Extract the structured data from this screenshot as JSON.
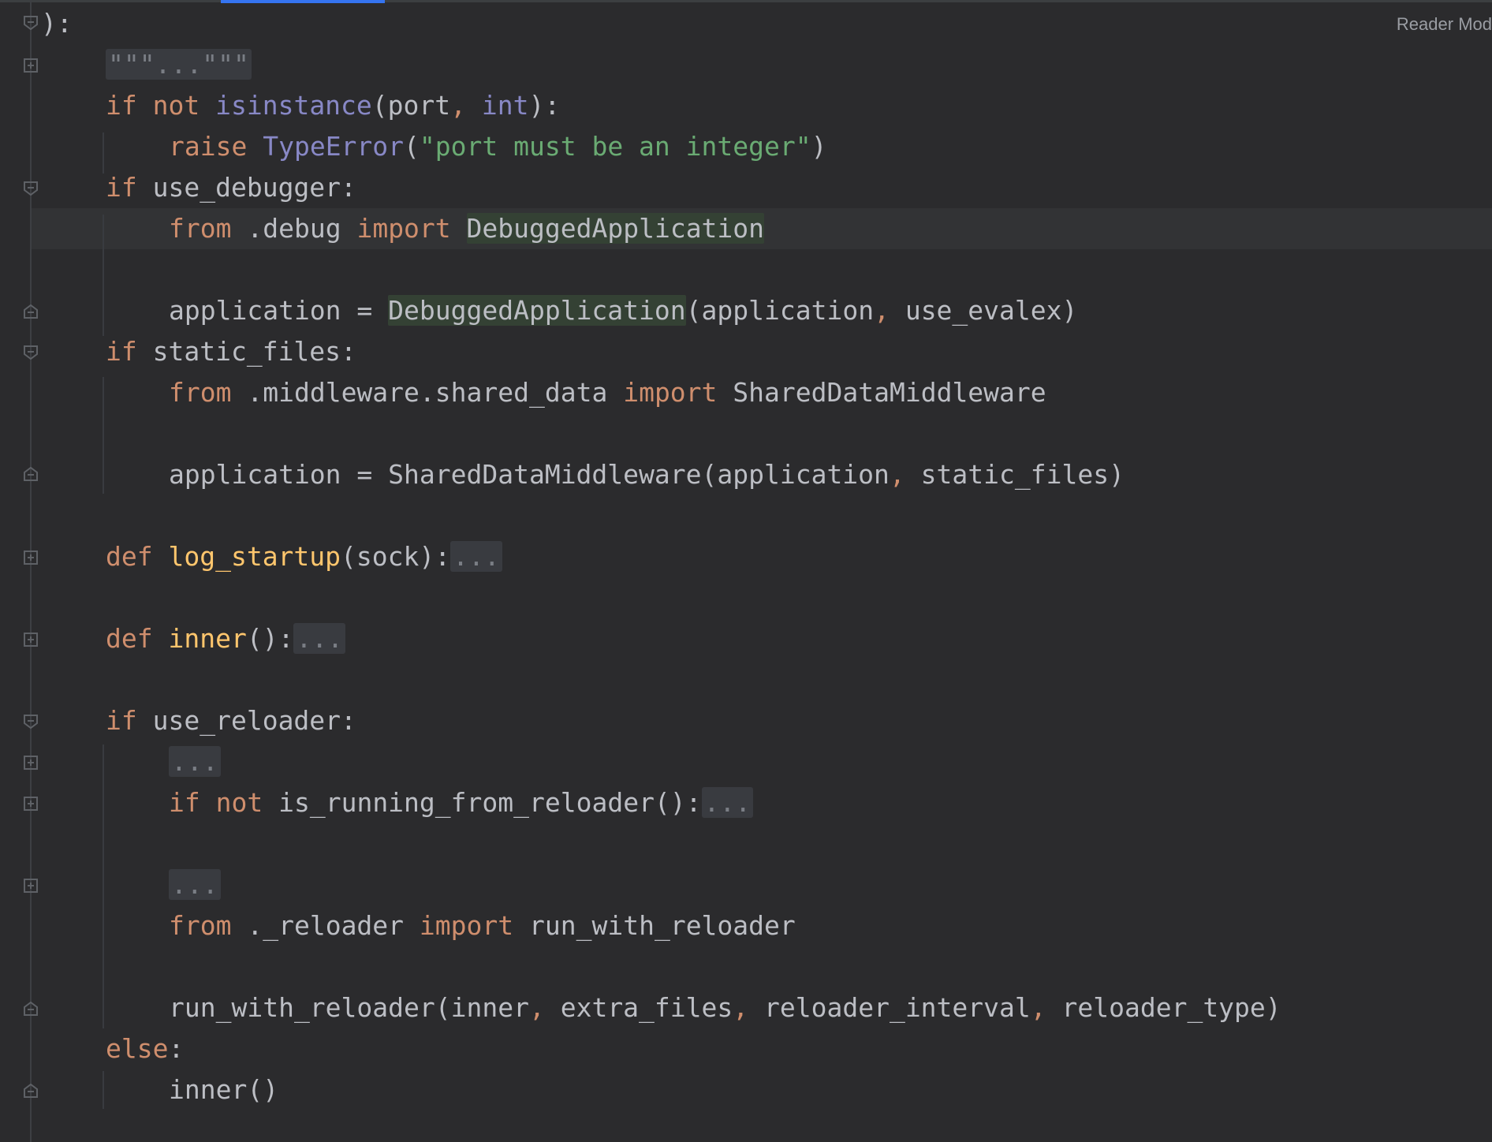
{
  "editor": {
    "reader_mode_label": "Reader Mod",
    "colors": {
      "background": "#2b2b2d",
      "keyword": "#cf8e6d",
      "builtin": "#8888c6",
      "string": "#6aab73",
      "function": "#ffc66d",
      "text": "#bcbec4",
      "usage_highlight": "#344134",
      "accent": "#3574f0"
    }
  },
  "code": {
    "l01": {
      "t1": "):"
    },
    "l02": {
      "t1": "\"\"\"...\"\"\""
    },
    "l03": {
      "t1": "if",
      "t2": "not",
      "t3": "isinstance",
      "t4": "(port",
      "t5": ",",
      "t6": "int",
      "t7": "):"
    },
    "l04": {
      "t1": "raise",
      "t2": "TypeError",
      "t3": "(",
      "t4": "\"port must be an integer\"",
      "t5": ")"
    },
    "l05": {
      "t1": "if",
      "t2": "use_debugger:"
    },
    "l06": {
      "t1": "from",
      "t2": ".debug",
      "t3": "import",
      "t4": "DebuggedApplication"
    },
    "l07": {
      "t1": "application = ",
      "t2": "DebuggedApplication",
      "t3": "(application",
      "t4": ",",
      "t5": " use_evalex)"
    },
    "l08": {
      "t1": "if",
      "t2": "static_files:"
    },
    "l09": {
      "t1": "from",
      "t2": ".middleware.shared_data",
      "t3": "import",
      "t4": "SharedDataMiddleware"
    },
    "l10": {
      "t1": "application = SharedDataMiddleware(application",
      "t2": ",",
      "t3": " static_files)"
    },
    "l11": {
      "t1": "def",
      "t2": "log_startup",
      "t3": "(sock):",
      "t4": "..."
    },
    "l12": {
      "t1": "def",
      "t2": "inner",
      "t3": "():",
      "t4": "..."
    },
    "l13": {
      "t1": "if",
      "t2": "use_reloader:"
    },
    "l14": {
      "t1": "..."
    },
    "l15": {
      "t1": "if",
      "t2": "not",
      "t3": "is_running_from_reloader():",
      "t4": "..."
    },
    "l16": {
      "t1": "..."
    },
    "l17": {
      "t1": "from",
      "t2": "._reloader",
      "t3": "import",
      "t4": "run_with_reloader"
    },
    "l18": {
      "t1": "run_with_reloader(inner",
      "t2": ",",
      "t3": " extra_files",
      "t4": ",",
      "t5": " reloader_interval",
      "t6": ",",
      "t7": " reloader_type)"
    },
    "l19": {
      "t1": "else",
      "t2": ":"
    },
    "l20": {
      "t1": "inner()"
    }
  }
}
